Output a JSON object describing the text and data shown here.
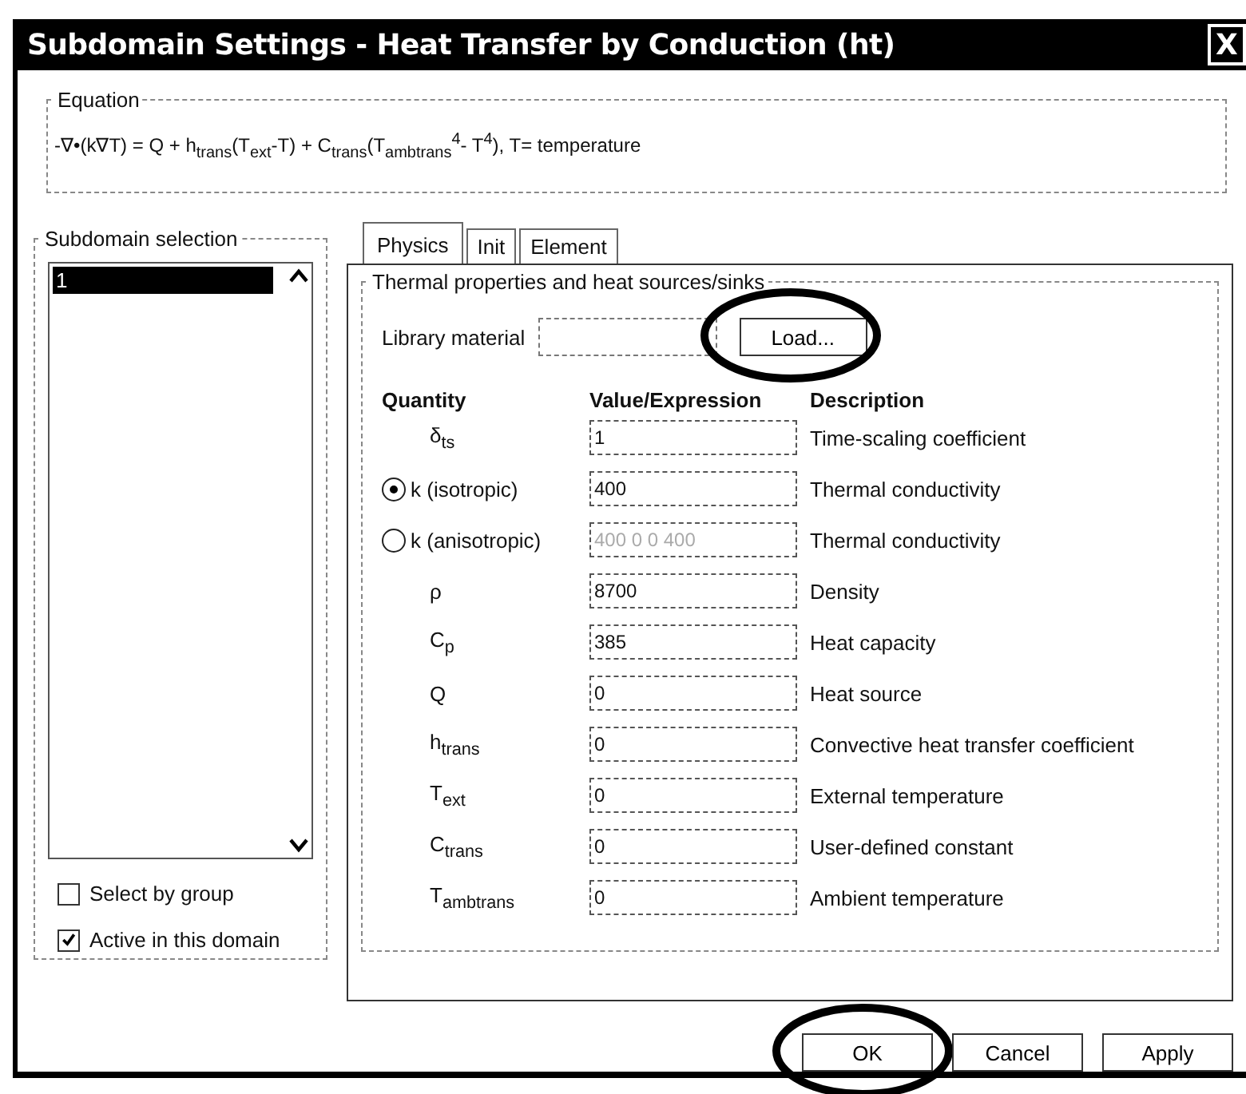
{
  "window": {
    "title": "Subdomain Settings - Heat Transfer by Conduction (ht)",
    "close": "X"
  },
  "equation": {
    "label": "Equation",
    "text": "-∇•(k∇T) = Q + h$_{trans}$(T$_{ext}$-T) + C$_{trans}$(T$_{ambtrans}$$^{4}$- T$^{4}$), T= temperature"
  },
  "subdomain_selection": {
    "label": "Subdomain selection",
    "items": [
      {
        "label": "1",
        "selected": true
      }
    ],
    "checkboxes": [
      {
        "label": "Select by group",
        "checked": false
      },
      {
        "label": "Active in this domain",
        "checked": true
      }
    ]
  },
  "tabs": [
    {
      "label": "Physics",
      "selected": true
    },
    {
      "label": "Init",
      "selected": false
    },
    {
      "label": "Element",
      "selected": false
    }
  ],
  "group": {
    "label": "Thermal properties and heat sources/sinks",
    "library_label": "Library material",
    "load_button": {
      "label": "Load...",
      "circled": true
    },
    "columns": [
      "Quantity",
      "Value/Expression",
      "Description"
    ],
    "rows": [
      {
        "kind": "plain",
        "quantity": "δ$_{ts}$",
        "value": "1",
        "description": "Time-scaling coefficient",
        "disabled": false
      },
      {
        "kind": "radio",
        "selected": true,
        "quantity": "k (isotropic)",
        "value": "400",
        "description": "Thermal conductivity",
        "disabled": false
      },
      {
        "kind": "radio",
        "selected": false,
        "quantity": "k (anisotropic)",
        "value": "400 0 0 400",
        "description": "Thermal conductivity",
        "disabled": true
      },
      {
        "kind": "plain",
        "quantity": "ρ",
        "value": "8700",
        "description": "Density",
        "disabled": false
      },
      {
        "kind": "plain",
        "quantity": "C$_{p}$",
        "value": "385",
        "description": "Heat capacity",
        "disabled": false
      },
      {
        "kind": "plain",
        "quantity": "Q",
        "value": "0",
        "description": "Heat source",
        "disabled": false
      },
      {
        "kind": "plain",
        "quantity": "h$_{trans}$",
        "value": "0",
        "description": "Convective heat transfer coefficient",
        "disabled": false
      },
      {
        "kind": "plain",
        "quantity": "T$_{ext}$",
        "value": "0",
        "description": "External temperature",
        "disabled": false
      },
      {
        "kind": "plain",
        "quantity": "C$_{trans}$",
        "value": "0",
        "description": "User-defined constant",
        "disabled": false
      },
      {
        "kind": "plain",
        "quantity": "T$_{ambtrans}$",
        "value": "0",
        "description": "Ambient temperature",
        "disabled": false
      }
    ]
  },
  "buttons": [
    {
      "label": "OK",
      "circled": true
    },
    {
      "label": "Cancel",
      "circled": false
    },
    {
      "label": "Apply",
      "circled": false
    }
  ]
}
